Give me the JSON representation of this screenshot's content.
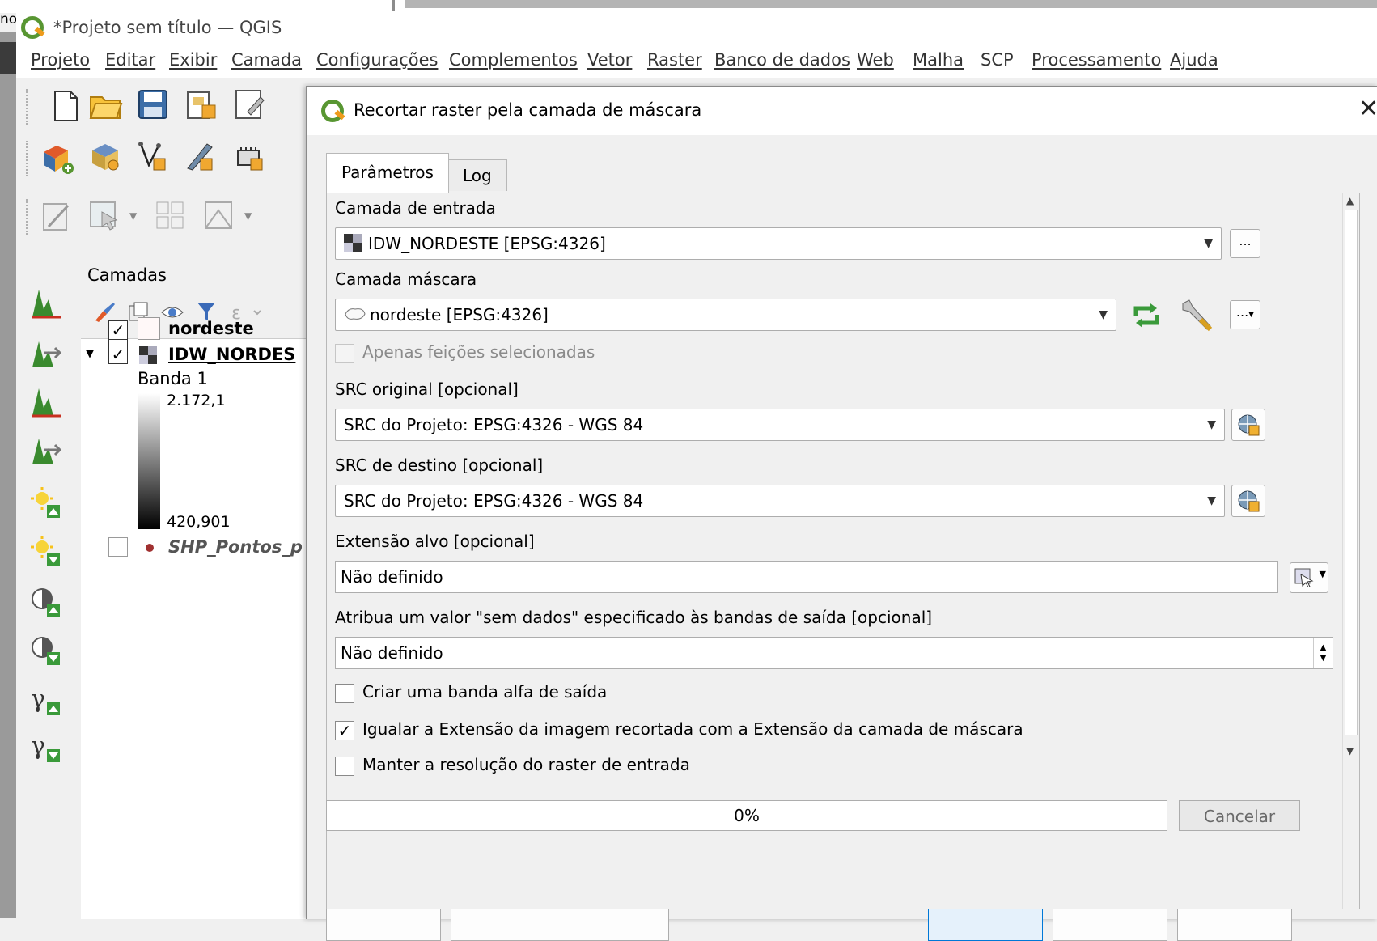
{
  "window": {
    "title": "*Projeto sem título — QGIS",
    "left_edge_text": "no"
  },
  "menubar": {
    "items": [
      {
        "label": "Projeto"
      },
      {
        "label": "Editar"
      },
      {
        "label": "Exibir"
      },
      {
        "label": "Camada"
      },
      {
        "label": "Configurações"
      },
      {
        "label": "Complementos"
      },
      {
        "label": "Vetor"
      },
      {
        "label": "Raster"
      },
      {
        "label": "Banco de dados"
      },
      {
        "label": "Web"
      },
      {
        "label": "Malha"
      },
      {
        "label": "SCP"
      },
      {
        "label": "Processamento"
      },
      {
        "label": "Ajuda"
      }
    ]
  },
  "toolbar_icons": {
    "row1": [
      "new-project-icon",
      "open-folder-icon",
      "save-icon",
      "new-print-layout-icon",
      "layout-manager-icon"
    ],
    "row2": [
      "data-source-manager-icon",
      "new-geopackage-icon",
      "digitize-vertex-icon",
      "edit-pencil-icon",
      "raster-tool-icon"
    ],
    "row3": [
      "toggle-editing-icon",
      "select-features-icon",
      "identify-icon",
      "vertex-tool-icon"
    ]
  },
  "layers_panel": {
    "title": "Camadas",
    "layers": [
      {
        "name": "nordeste",
        "checked": true
      },
      {
        "name": "IDW_NORDES",
        "checked": true,
        "band": "Banda 1",
        "max_value": "2.172,1",
        "min_value": "420,901"
      },
      {
        "name": "SHP_Pontos_p",
        "checked": false
      }
    ]
  },
  "dialog": {
    "title": "Recortar raster pela camada de máscara",
    "tabs": [
      {
        "label": "Parâmetros",
        "active": true
      },
      {
        "label": "Log",
        "active": false
      }
    ],
    "input_layer": {
      "label": "Camada de entrada",
      "value": "IDW_NORDESTE [EPSG:4326]"
    },
    "mask_layer": {
      "label": "Camada máscara",
      "value": "nordeste [EPSG:4326]"
    },
    "selected_only": {
      "label": "Apenas feições selecionadas",
      "checked": false,
      "enabled": false
    },
    "source_crs": {
      "label": "SRC original [opcional]",
      "value": "SRC do Projeto: EPSG:4326 - WGS 84"
    },
    "target_crs": {
      "label": "SRC de destino [opcional]",
      "value": "SRC do Projeto: EPSG:4326 - WGS 84"
    },
    "target_extent": {
      "label": "Extensão alvo [opcional]",
      "value": "Não definido"
    },
    "nodata": {
      "label": "Atribua um valor \"sem dados\" especificado às bandas de saída [opcional]",
      "value": "Não definido"
    },
    "alpha_band": {
      "label": "Criar uma banda alfa de saída",
      "checked": false
    },
    "crop_to_cutline": {
      "label": "Igualar a Extensão da imagem recortada com a Extensão da camada de máscara",
      "checked": true
    },
    "keep_resolution": {
      "label": "Manter a resolução do raster de entrada",
      "checked": false
    },
    "ellipsis": "...",
    "progress": {
      "value": 0,
      "text": "0%"
    },
    "cancel_label": "Cancelar"
  },
  "colors": {
    "qgis_green": "#589632",
    "qgis_orange": "#ee9b1c",
    "focus_blue": "#0078d7"
  }
}
